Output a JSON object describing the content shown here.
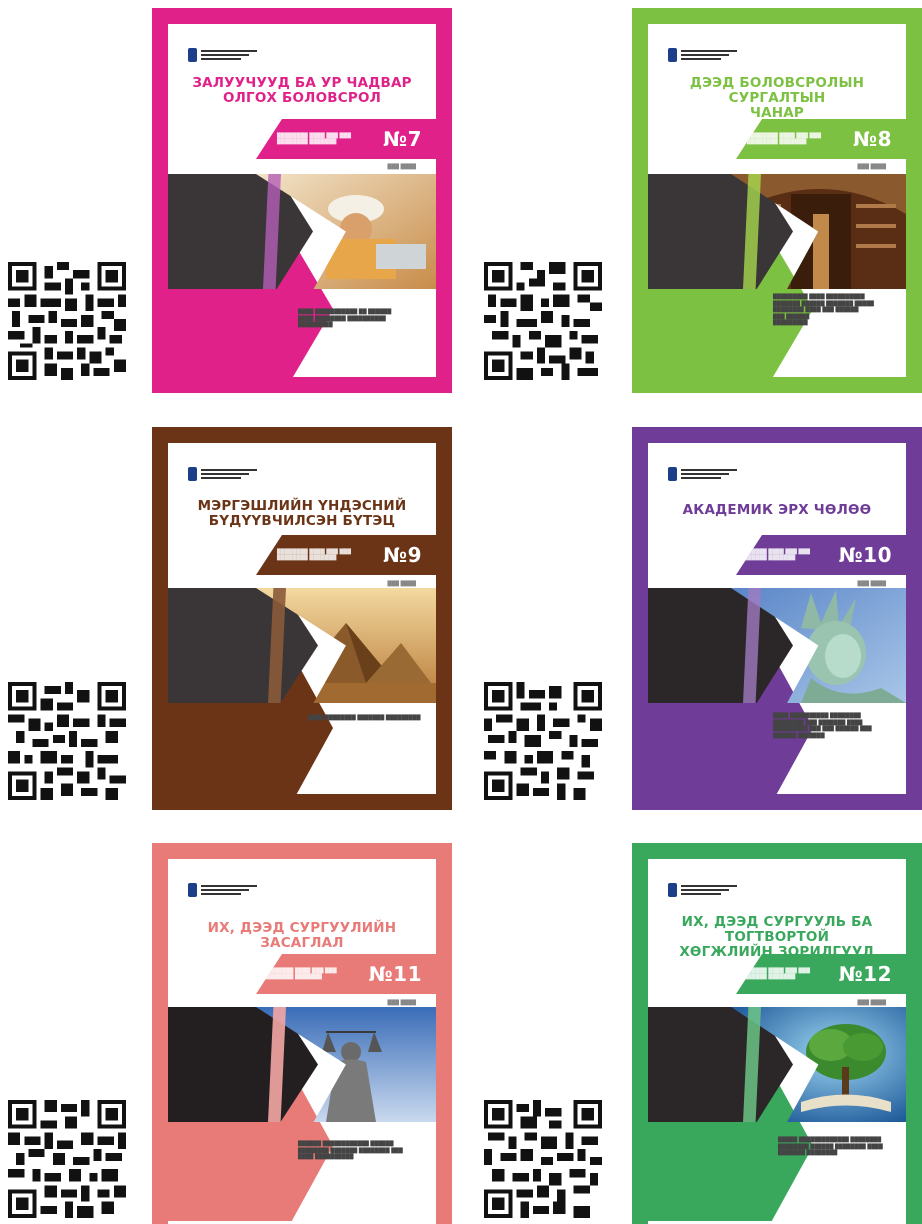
{
  "covers": [
    {
      "title": "ЗАЛУУЧУУД БА УР ЧАДВАР\nОЛГОХ БОЛОВСРОЛ",
      "issue": "№7",
      "color": "#e0218a",
      "title_color": "#e0218a",
      "photo": "workers"
    },
    {
      "title": "ДЭЭД БОЛОВСРОЛЫН СУРГАЛТЫН\nЧАНАР",
      "issue": "№8",
      "color": "#7dc142",
      "title_color": "#7dc142",
      "photo": "library"
    },
    {
      "title": "МЭРГЭШЛИЙН ҮНДЭСНИЙ\nБҮДҮҮВЧИЛСЭН БҮТЭЦ",
      "issue": "№9",
      "color": "#6b3416",
      "title_color": "#6b3416",
      "photo": "pyramids"
    },
    {
      "title": "АКАДЕМИК ЭРХ ЧӨЛӨӨ",
      "issue": "№10",
      "color": "#6f3c97",
      "title_color": "#6f3c97",
      "photo": "liberty"
    },
    {
      "title": "ИХ, ДЭЭД СУРГУУЛИЙН ЗАСАГЛАЛ",
      "issue": "№11",
      "color": "#e87a78",
      "title_color": "#e87a78",
      "photo": "justice"
    },
    {
      "title": "ИХ, ДЭЭД СУРГУУЛЬ БА ТОГТВОРТОЙ\nХӨГЖЛИЙН ЗОРИЛГУУД",
      "issue": "№12",
      "color": "#3aa85c",
      "title_color": "#3aa85c",
      "photo": "tree"
    }
  ]
}
